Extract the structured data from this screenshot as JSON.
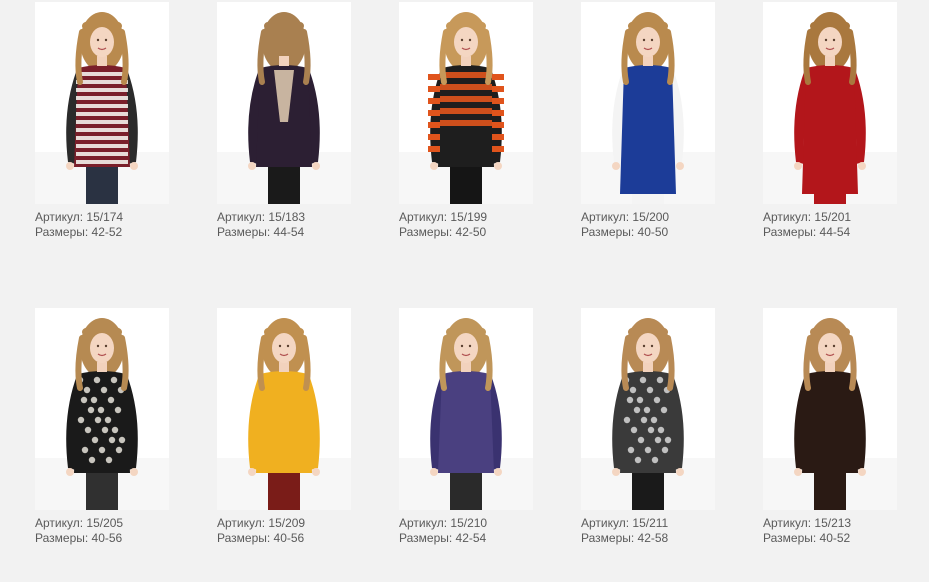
{
  "catalog": {
    "items": [
      {
        "article_label": "Артикул: 15/174",
        "sizes_label": "Размеры: 42-52",
        "colors": {
          "hair": "#b98a4e",
          "top": "#7a1f2a",
          "stripe": "#f3f0ea",
          "sleeve": "#2b2b2b",
          "bottom": "#2a3242"
        },
        "pattern": "stripes",
        "view": "front"
      },
      {
        "article_label": "Артикул: 15/183",
        "sizes_label": "Размеры: 44-54",
        "colors": {
          "hair": "#a98050",
          "top": "#2c1f33",
          "stripe": "#c8b4a0",
          "sleeve": "#2c1f33",
          "bottom": "#1a1a1a"
        },
        "pattern": "back-lace",
        "view": "back"
      },
      {
        "article_label": "Артикул: 15/199",
        "sizes_label": "Размеры: 42-50",
        "colors": {
          "hair": "#c7995a",
          "top": "#1e1e1e",
          "stripe": "#e0541c",
          "sleeve": "#1e1e1e",
          "bottom": "#151515"
        },
        "pattern": "stripes-wide",
        "view": "front"
      },
      {
        "article_label": "Артикул: 15/200",
        "sizes_label": "Размеры: 40-50",
        "colors": {
          "hair": "#b98a4e",
          "top": "#1c3c98",
          "stripe": "#f4f4f4",
          "sleeve": "#f4f4f4",
          "bottom": "#f4f4f4"
        },
        "pattern": "dress",
        "view": "front"
      },
      {
        "article_label": "Артикул: 15/201",
        "sizes_label": "Размеры: 44-54",
        "colors": {
          "hair": "#a9783e",
          "top": "#b3161b",
          "stripe": "#b3161b",
          "sleeve": "#b3161b",
          "bottom": "#b3161b"
        },
        "pattern": "dress-long",
        "view": "front"
      },
      {
        "article_label": "Артикул: 15/205",
        "sizes_label": "Размеры: 40-56",
        "colors": {
          "hair": "#b68a52",
          "top": "#1a1a1a",
          "stripe": "#e8e4dc",
          "sleeve": "#1a1a1a",
          "bottom": "#303030"
        },
        "pattern": "paisley",
        "view": "front"
      },
      {
        "article_label": "Артикул: 15/209",
        "sizes_label": "Размеры: 40-56",
        "colors": {
          "hair": "#c09050",
          "top": "#f0b020",
          "stripe": "#f0b020",
          "sleeve": "#f0b020",
          "bottom": "#7a1c18"
        },
        "pattern": "plain",
        "view": "front"
      },
      {
        "article_label": "Артикул: 15/210",
        "sizes_label": "Размеры: 42-54",
        "colors": {
          "hair": "#c0965a",
          "top": "#4a4080",
          "stripe": "#4a4080",
          "sleeve": "#3a3270",
          "bottom": "#2a2a2a"
        },
        "pattern": "plain",
        "view": "front"
      },
      {
        "article_label": "Артикул: 15/211",
        "sizes_label": "Размеры: 42-58",
        "colors": {
          "hair": "#b88a55",
          "top": "#3a3a3a",
          "stripe": "#d8d8d8",
          "sleeve": "#3a3a3a",
          "bottom": "#1a1a1a"
        },
        "pattern": "print",
        "view": "front"
      },
      {
        "article_label": "Артикул: 15/213",
        "sizes_label": "Размеры: 40-52",
        "colors": {
          "hair": "#b88a55",
          "top": "#2a1a14",
          "stripe": "#2a1a14",
          "sleeve": "#2a1a14",
          "bottom": "#2a1a14"
        },
        "pattern": "plain",
        "view": "front"
      }
    ]
  }
}
